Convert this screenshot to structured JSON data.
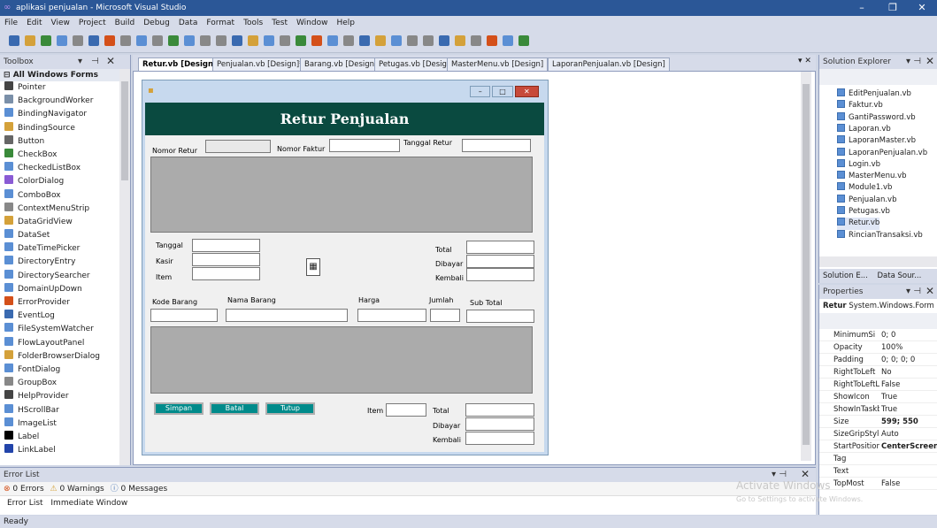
{
  "titlebar": {
    "title": "aplikasi penjualan - Microsoft Visual Studio"
  },
  "menu": [
    "File",
    "Edit",
    "View",
    "Project",
    "Build",
    "Debug",
    "Data",
    "Format",
    "Tools",
    "Test",
    "Window",
    "Help"
  ],
  "toolbox": {
    "title": "Toolbox",
    "section": "All Windows Forms",
    "items": [
      {
        "label": "Pointer",
        "icon": "pointer-icon",
        "color": "#444"
      },
      {
        "label": "BackgroundWorker",
        "icon": "background-worker-icon",
        "color": "#7a8fa8"
      },
      {
        "label": "BindingNavigator",
        "icon": "binding-navigator-icon",
        "color": "#5b8fd4"
      },
      {
        "label": "BindingSource",
        "icon": "binding-source-icon",
        "color": "#d4a13a"
      },
      {
        "label": "Button",
        "icon": "button-icon",
        "color": "#666"
      },
      {
        "label": "CheckBox",
        "icon": "checkbox-icon",
        "color": "#3a8a3a"
      },
      {
        "label": "CheckedListBox",
        "icon": "checked-listbox-icon",
        "color": "#5b8fd4"
      },
      {
        "label": "ColorDialog",
        "icon": "color-dialog-icon",
        "color": "#8a5bd4"
      },
      {
        "label": "ComboBox",
        "icon": "combobox-icon",
        "color": "#5b8fd4"
      },
      {
        "label": "ContextMenuStrip",
        "icon": "context-menu-icon",
        "color": "#888"
      },
      {
        "label": "DataGridView",
        "icon": "datagrid-icon",
        "color": "#d4a13a"
      },
      {
        "label": "DataSet",
        "icon": "dataset-icon",
        "color": "#5b8fd4"
      },
      {
        "label": "DateTimePicker",
        "icon": "datetime-picker-icon",
        "color": "#5b8fd4"
      },
      {
        "label": "DirectoryEntry",
        "icon": "directory-entry-icon",
        "color": "#5b8fd4"
      },
      {
        "label": "DirectorySearcher",
        "icon": "directory-searcher-icon",
        "color": "#5b8fd4"
      },
      {
        "label": "DomainUpDown",
        "icon": "domain-updown-icon",
        "color": "#5b8fd4"
      },
      {
        "label": "ErrorProvider",
        "icon": "error-provider-icon",
        "color": "#d4501a"
      },
      {
        "label": "EventLog",
        "icon": "eventlog-icon",
        "color": "#3a6ab0"
      },
      {
        "label": "FileSystemWatcher",
        "icon": "filesystem-watcher-icon",
        "color": "#5b8fd4"
      },
      {
        "label": "FlowLayoutPanel",
        "icon": "flowlayout-icon",
        "color": "#5b8fd4"
      },
      {
        "label": "FolderBrowserDialog",
        "icon": "folder-browser-icon",
        "color": "#d4a13a"
      },
      {
        "label": "FontDialog",
        "icon": "font-dialog-icon",
        "color": "#5b8fd4"
      },
      {
        "label": "GroupBox",
        "icon": "groupbox-icon",
        "color": "#888"
      },
      {
        "label": "HelpProvider",
        "icon": "help-provider-icon",
        "color": "#444"
      },
      {
        "label": "HScrollBar",
        "icon": "hscrollbar-icon",
        "color": "#5b8fd4"
      },
      {
        "label": "ImageList",
        "icon": "imagelist-icon",
        "color": "#5b8fd4"
      },
      {
        "label": "Label",
        "icon": "label-icon",
        "color": "#000"
      },
      {
        "label": "LinkLabel",
        "icon": "linklabel-icon",
        "color": "#2244aa"
      }
    ]
  },
  "tabs": [
    {
      "label": "Retur.vb [Design]",
      "active": true
    },
    {
      "label": "Penjualan.vb [Design]*",
      "active": false
    },
    {
      "label": "Barang.vb [Design]",
      "active": false
    },
    {
      "label": "Petugas.vb [Design]",
      "active": false
    },
    {
      "label": "MasterMenu.vb [Design]",
      "active": false
    },
    {
      "label": "LaporanPenjualan.vb [Design]",
      "active": false
    }
  ],
  "form": {
    "header": "Retur Penjualan",
    "labels": {
      "nomor_retur": "Nomor Retur",
      "nomor_faktur": "Nomor Faktur",
      "tanggal_retur": "Tanggal Retur",
      "tanggal": "Tanggal",
      "kasir": "Kasir",
      "item": "Item",
      "total": "Total",
      "dibayar": "Dibayar",
      "kembali": "Kembali",
      "kode_barang": "Kode Barang",
      "nama_barang": "Nama Barang",
      "harga": "Harga",
      "jumlah": "Jumlah",
      "sub_total": "Sub Total",
      "item2": "Item",
      "total2": "Total",
      "dibayar2": "Dibayar",
      "kembali2": "Kembali"
    },
    "buttons": {
      "simpan": "Simpan",
      "batal": "Batal",
      "tutup": "Tutup"
    }
  },
  "errorlist": {
    "title": "Error List",
    "errors": "0 Errors",
    "warnings": "0 Warnings",
    "messages": "0 Messages",
    "tab1": "Error List",
    "tab2": "Immediate Window"
  },
  "status": "Ready",
  "solution": {
    "title": "Solution Explorer",
    "items": [
      "EditPenjualan.vb",
      "Faktur.vb",
      "GantiPassword.vb",
      "Laporan.vb",
      "LaporanMaster.vb",
      "LaporanPenjualan.vb",
      "Login.vb",
      "MasterMenu.vb",
      "Module1.vb",
      "Penjualan.vb",
      "Petugas.vb",
      "Retur.vb",
      "RincianTransaksi.vb"
    ],
    "tab1": "Solution E...",
    "tab2": "Data Sour..."
  },
  "properties": {
    "title": "Properties",
    "object_name": "Retur",
    "object_type": "System.Windows.Form",
    "rows": [
      {
        "name": "MinimumSi",
        "value": "0; 0",
        "bold": false
      },
      {
        "name": "Opacity",
        "value": "100%",
        "bold": false
      },
      {
        "name": "Padding",
        "value": "0; 0; 0; 0",
        "bold": false
      },
      {
        "name": "RightToLeft",
        "value": "No",
        "bold": false
      },
      {
        "name": "RightToLeftL",
        "value": "False",
        "bold": false
      },
      {
        "name": "ShowIcon",
        "value": "True",
        "bold": false
      },
      {
        "name": "ShowInTaskb",
        "value": "True",
        "bold": false
      },
      {
        "name": "Size",
        "value": "599; 550",
        "bold": true
      },
      {
        "name": "SizeGripStyle",
        "value": "Auto",
        "bold": false
      },
      {
        "name": "StartPosition",
        "value": "CenterScreen",
        "bold": true
      },
      {
        "name": "Tag",
        "value": "",
        "bold": false
      },
      {
        "name": "Text",
        "value": "",
        "bold": false
      },
      {
        "name": "TopMost",
        "value": "False",
        "bold": false
      }
    ]
  },
  "watermark": {
    "line1": "Activate Windows",
    "line2": "Go to Settings to activate Windows."
  }
}
